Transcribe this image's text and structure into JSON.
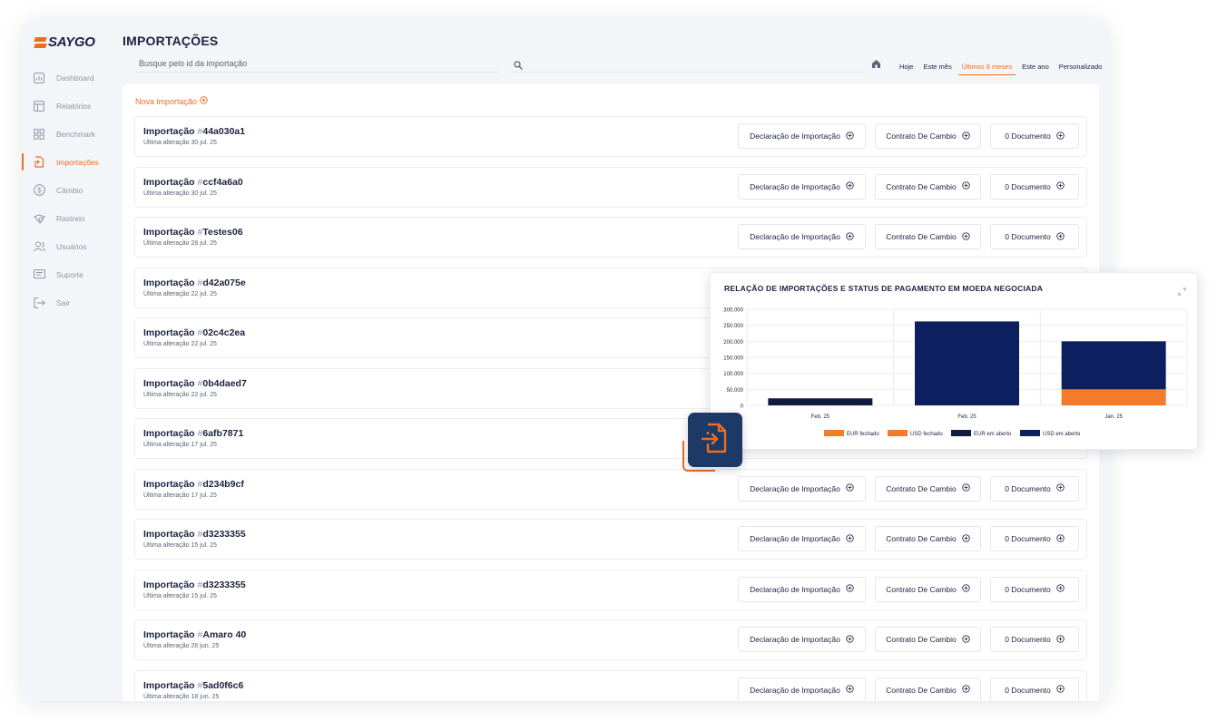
{
  "app": {
    "logo_text": "SAYGO",
    "page_title": "IMPORTAÇÕES"
  },
  "sidebar": {
    "items": [
      {
        "label": "Dashboard",
        "icon": "bar-chart-icon"
      },
      {
        "label": "Relatórios",
        "icon": "report-icon"
      },
      {
        "label": "Benchmark",
        "icon": "grid-icon"
      },
      {
        "label": "Importações",
        "icon": "document-import-icon",
        "active": true
      },
      {
        "label": "Câmbio",
        "icon": "dollar-icon"
      },
      {
        "label": "Rastreio",
        "icon": "tracking-icon"
      },
      {
        "label": "Usuários",
        "icon": "users-icon"
      },
      {
        "label": "Suporte",
        "icon": "chat-icon"
      },
      {
        "label": "Sair",
        "icon": "logout-icon"
      }
    ]
  },
  "search": {
    "placeholder": "Busque pelo id da importação"
  },
  "filters": [
    "Hoje",
    "Este mês",
    "Últimos 6 meses",
    "Este ano",
    "Personalizado"
  ],
  "active_filter": "Últimos 6 meses",
  "new_import_label": "Nova importação",
  "row_labels": {
    "prefix": "Importação",
    "hash": "#",
    "sub_prefix": "Última alteração",
    "btn_declaracao": "Declaração de Importação",
    "btn_contrato": "Contrato De Cambio",
    "btn_documento": "0 Documento"
  },
  "imports": [
    {
      "id": "44a030a1",
      "date": "30 jul. 25"
    },
    {
      "id": "ccf4a6a0",
      "date": "30 jul. 25"
    },
    {
      "id": "Testes06",
      "date": "28 jul. 25"
    },
    {
      "id": "d42a075e",
      "date": "22 jul. 25"
    },
    {
      "id": "02c4c2ea",
      "date": "22 jul. 25"
    },
    {
      "id": "0b4daed7",
      "date": "22 jul. 25"
    },
    {
      "id": "6afb7871",
      "date": "17 jul. 25"
    },
    {
      "id": "d234b9cf",
      "date": "17 jul. 25"
    },
    {
      "id": "d3233355",
      "date": "15 jul. 25"
    },
    {
      "id": "d3233355",
      "date": "15 jul. 25"
    },
    {
      "id": "Amaro 40",
      "date": "26 jun. 25"
    },
    {
      "id": "5ad0f6c6",
      "date": "18 jun. 25"
    }
  ],
  "colors": {
    "accent": "#ee6c24",
    "navy": "#1b2240",
    "badge": "#1d3a66"
  },
  "chart_data": {
    "type": "bar",
    "stacked": true,
    "title": "RELAÇÃO DE IMPORTAÇÕES E STATUS DE PAGAMENTO EM MOEDA NEGOCIADA",
    "categories": [
      "Feb. 25",
      "Feb. 25",
      "Jan. 25"
    ],
    "yticks": [
      "0",
      "50.000",
      "100.000",
      "150.000",
      "200.000",
      "250.000",
      "300.000"
    ],
    "ylim": [
      0,
      300000
    ],
    "series": [
      {
        "name": "EUR fechado",
        "color": "#f47b2a",
        "values": [
          0,
          0,
          0
        ]
      },
      {
        "name": "USD fechado",
        "color": "#f47b2a",
        "values": [
          0,
          0,
          50000
        ]
      },
      {
        "name": "EUR em aberto",
        "color": "#111a3f",
        "values": [
          22000,
          0,
          0
        ]
      },
      {
        "name": "USD em aberto",
        "color": "#0c2060",
        "values": [
          0,
          262000,
          150000
        ]
      }
    ],
    "legend_position": "bottom",
    "grid": true
  }
}
